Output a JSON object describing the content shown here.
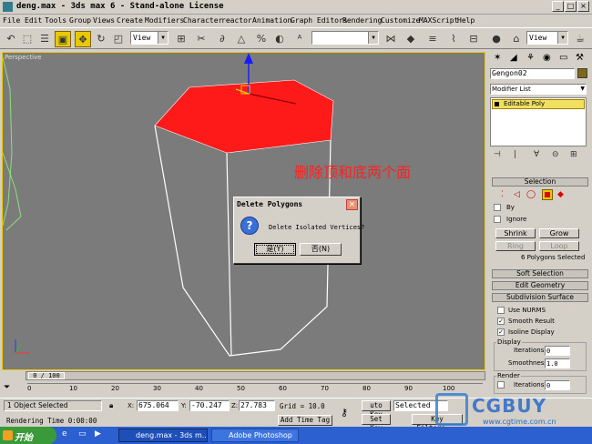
{
  "window": {
    "title": "deng.max - 3ds max 6 - Stand-alone License",
    "controls": [
      "_",
      "□",
      "×"
    ]
  },
  "menu": [
    "File",
    "Edit",
    "Tools",
    "Group",
    "Views",
    "Create",
    "Modifiers",
    "Character",
    "reactor",
    "Animation",
    "Graph Editors",
    "Rendering",
    "Customize",
    "MAXScript",
    "Help"
  ],
  "toolbar": {
    "view_dropdown": "View",
    "named_selection": "",
    "view_dropdown2": "View"
  },
  "viewport": {
    "label": "Perspective",
    "annotation": "删除顶和底两个面",
    "colors": {
      "selected_face": "#ff1a1a",
      "background": "#7b7b7b",
      "wire": "#ffffff",
      "gizmo": "#1a1aff"
    }
  },
  "dialog": {
    "title": "Delete Polygons",
    "message": "Delete Isolated Vertices?",
    "yes_label": "是(Y)",
    "no_label": "否(N)",
    "close": "×"
  },
  "command_panel": {
    "object_name": "Gengon02",
    "modifier_list": "Modifier List",
    "stack_item": "Editable Poly",
    "selection": {
      "header": "Selection",
      "by_label": "By",
      "ignore_label": "Ignore",
      "shrink": "Shrink",
      "grow": "Grow",
      "ring": "Ring",
      "loop": "Loop",
      "status": "6 Polygons Selected"
    },
    "soft_selection": "Soft Selection",
    "edit_geometry": "Edit Geometry",
    "subdivision": {
      "header": "Subdivision Surface",
      "use_nurms": "Use NURMS",
      "smooth_result": "Smooth Result",
      "isoline_display": "Isoline Display",
      "display_label": "Display",
      "iterations_label": "Iterations:",
      "iterations_value": "0",
      "smoothness_label": "Smoothness:",
      "smoothness_value": "1.0",
      "render_label": "Render",
      "render_iterations_label": "Iterations:",
      "render_iterations_value": "0"
    }
  },
  "timeline": {
    "frame_display": "0 / 100",
    "ticks": [
      "0",
      "10",
      "20",
      "30",
      "40",
      "50",
      "60",
      "70",
      "80",
      "90",
      "100"
    ]
  },
  "status": {
    "selection": "1 Object Selected",
    "render_time": "Rendering Time  0:00:00",
    "x_label": "X:",
    "x_value": "675.064",
    "y_label": "Y:",
    "y_value": "-70.247",
    "z_label": "Z:",
    "z_value": "27.783",
    "grid": "Grid = 10.0",
    "add_time_tag": "Add Time Tag",
    "auto_key": "uto Key",
    "set_key": "Set Key",
    "selected": "Selected",
    "key_filters": "Key Filters..."
  },
  "taskbar": {
    "start": "开始",
    "tasks": [
      "deng.max - 3ds m...",
      "Adobe Photoshop"
    ]
  },
  "watermark": {
    "brand": "CGBUY",
    "url": "www.cgtime.com.cn"
  }
}
